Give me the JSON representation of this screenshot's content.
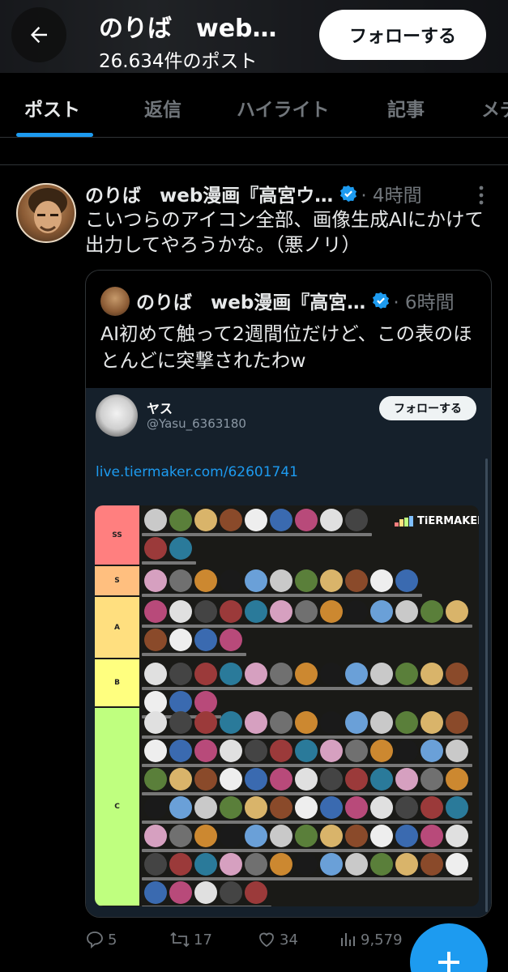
{
  "header": {
    "name": "のりば　web…",
    "post_count": "26.634件のポスト",
    "follow_label": "フォローする"
  },
  "tabs": [
    {
      "label": "ポスト",
      "active": true
    },
    {
      "label": "返信",
      "active": false
    },
    {
      "label": "ハイライト",
      "active": false
    },
    {
      "label": "記事",
      "active": false
    },
    {
      "label": "メデ",
      "active": false
    }
  ],
  "tweet": {
    "author": "のりば　web漫画『高宮ウ…",
    "time": "· 4時間",
    "text": "こいつらのアイコン全部、画像生成AIにかけて出力してやろうかな。（悪ノリ）",
    "quote": {
      "author": "のりば　web漫画『高宮…",
      "time": "· 6時間",
      "text": "AI初めて触って2週間位だけど、この表のほとんどに突撃されたわw",
      "embed": {
        "name": "ヤス",
        "handle": "@Yasu_6363180",
        "follow_label": "フォローする",
        "link": "live.tiermaker.com/62601741",
        "tiermaker_logo": "TiERMAKER",
        "tiers": [
          {
            "label": "SS",
            "color": "#ff7f7f"
          },
          {
            "label": "S",
            "color": "#ffbf7f"
          },
          {
            "label": "A",
            "color": "#ffdf7f"
          },
          {
            "label": "B",
            "color": "#ffff7f"
          },
          {
            "label": "C",
            "color": "#bfff7f"
          }
        ]
      }
    },
    "stats": {
      "replies": "5",
      "reposts": "17",
      "likes": "34",
      "views": "9,579"
    }
  },
  "colors": {
    "accent": "#1d9bf0",
    "background": "#000000",
    "muted": "#71767b"
  }
}
